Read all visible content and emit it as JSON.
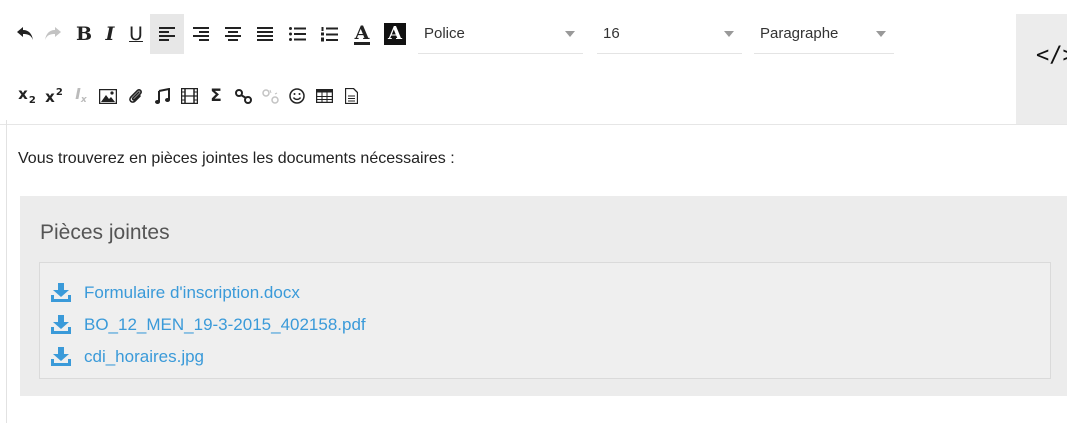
{
  "toolbar": {
    "font_dropdown": "Police",
    "size_dropdown": "16",
    "format_dropdown": "Paragraphe",
    "text_color_glyph": "A",
    "bg_color_glyph": "A",
    "bold_glyph": "B",
    "italic_glyph": "I",
    "underline_glyph": "U",
    "subscript_base": "x",
    "subscript_mark": "2",
    "superscript_base": "x",
    "superscript_mark": "2",
    "clear_format_base": "I",
    "clear_format_mark": "x",
    "sigma_glyph": "Σ",
    "source_glyph": "</>"
  },
  "content": {
    "paragraph": "Vous trouverez en pièces jointes les documents nécessaires :"
  },
  "attachments": {
    "title": "Pièces jointes",
    "files": [
      "Formulaire d'inscription.docx",
      "BO_12_MEN_19-3-2015_402158.pdf",
      "cdi_horaires.jpg"
    ]
  },
  "colors": {
    "link": "#3a9ad9",
    "panel_bg": "#ececec",
    "active_button_bg": "#e7e7e7"
  }
}
